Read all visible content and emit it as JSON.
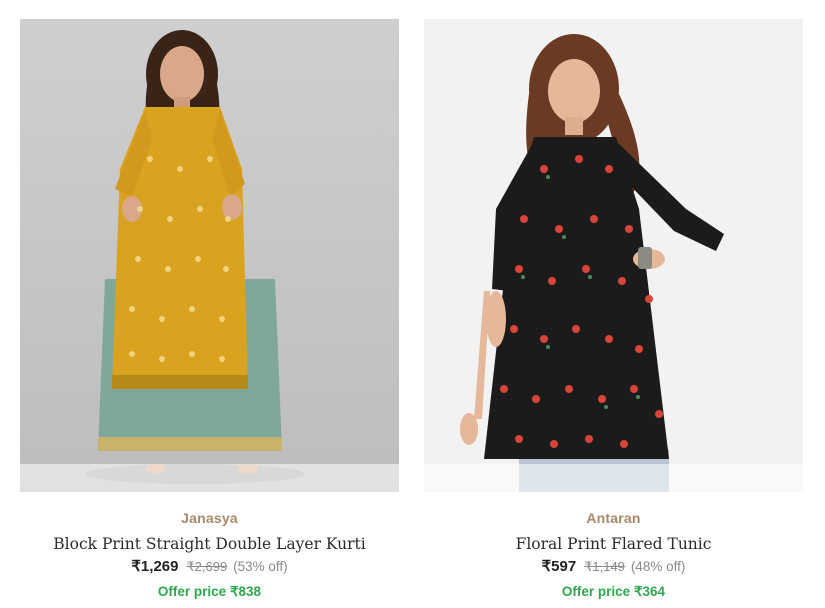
{
  "products": [
    {
      "brand": "Janasya",
      "title": "Block Print Straight Double Layer Kurti",
      "price": "₹1,269",
      "mrp": "₹2,699",
      "discount": "(53% off)",
      "offer": "Offer price ₹838",
      "image_icon": "model-wearing-mustard-kurti-image"
    },
    {
      "brand": "Antaran",
      "title": "Floral Print Flared Tunic",
      "price": "₹597",
      "mrp": "₹1,149",
      "discount": "(48% off)",
      "offer": "Offer price ₹364",
      "image_icon": "model-wearing-black-floral-tunic-image"
    }
  ],
  "colors": {
    "brand": "#a8896a",
    "offer": "#2ea84d",
    "mustard": "#d9a21f",
    "sage": "#7fa89b",
    "tunic_black": "#1c1b1b",
    "print_red": "#d9443a"
  }
}
